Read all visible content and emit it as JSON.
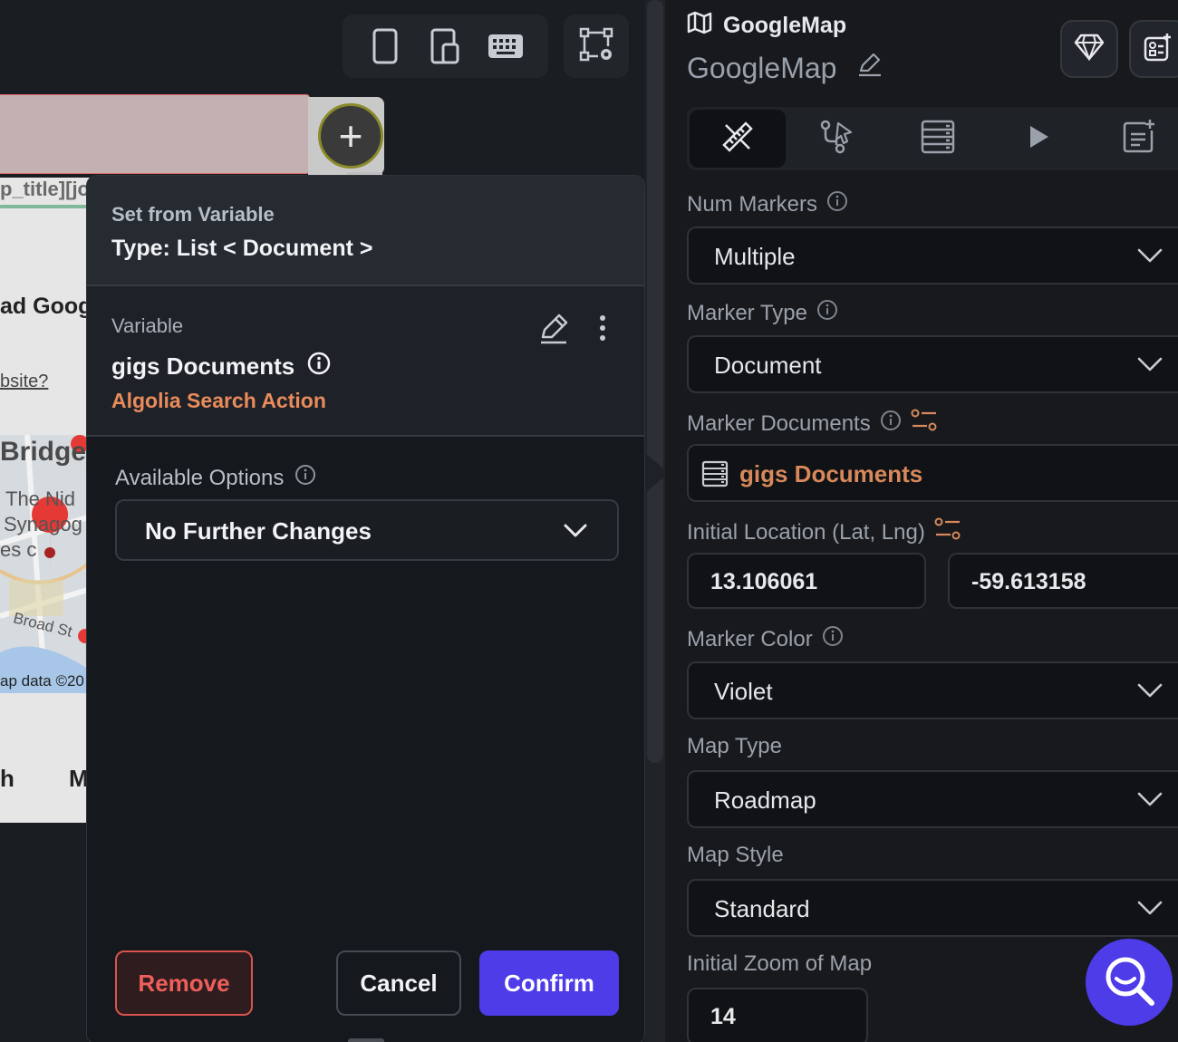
{
  "canvas": {
    "title_snippet": "p_title][jo",
    "page_text_1": "ad Goog",
    "page_text_2": "bsite?",
    "map_labels": [
      "Bridge",
      "The Nid",
      "Synagog",
      "es c",
      "Broad St"
    ],
    "map_credit": "ap data ©20",
    "page_text_3": "h",
    "page_text_4": "M"
  },
  "popover": {
    "header_title": "Set from Variable",
    "header_type": "Type: List < Document >",
    "variable_label": "Variable",
    "variable_name": "gigs Documents",
    "variable_source": "Algolia Search Action",
    "options_label": "Available Options",
    "options_value": "No Further Changes",
    "remove_label": "Remove",
    "cancel_label": "Cancel",
    "confirm_label": "Confirm"
  },
  "panel": {
    "widget_type": "GoogleMap",
    "widget_name": "GoogleMap",
    "num_markers_label": "Num Markers",
    "num_markers_value": "Multiple",
    "marker_type_label": "Marker Type",
    "marker_type_value": "Document",
    "marker_docs_label": "Marker Documents",
    "marker_docs_value": "gigs Documents",
    "initial_location_label": "Initial Location (Lat, Lng)",
    "lat": "13.106061",
    "lng": "-59.613158",
    "marker_color_label": "Marker Color",
    "marker_color_value": "Violet",
    "map_type_label": "Map Type",
    "map_type_value": "Roadmap",
    "map_style_label": "Map Style",
    "map_style_value": "Standard",
    "initial_zoom_label": "Initial Zoom of Map",
    "initial_zoom_value": "14"
  },
  "colors": {
    "accent": "#4d3ce8",
    "danger": "#ee5f5b",
    "variable_source": "#e98b5a"
  },
  "icons": [
    "phone-icon",
    "tablet-icon",
    "keyboard-icon",
    "canvas-settings-icon",
    "plus-icon",
    "edit-icon",
    "more-vertical-icon",
    "info-icon",
    "chevron-down-icon",
    "map-icon",
    "gem-icon",
    "add-widget-icon",
    "properties-tab-icon",
    "actions-tab-icon",
    "backend-query-tab-icon",
    "run-tab-icon",
    "docs-tab-icon",
    "data-source-icon",
    "variable-bind-icon",
    "search-icon"
  ]
}
